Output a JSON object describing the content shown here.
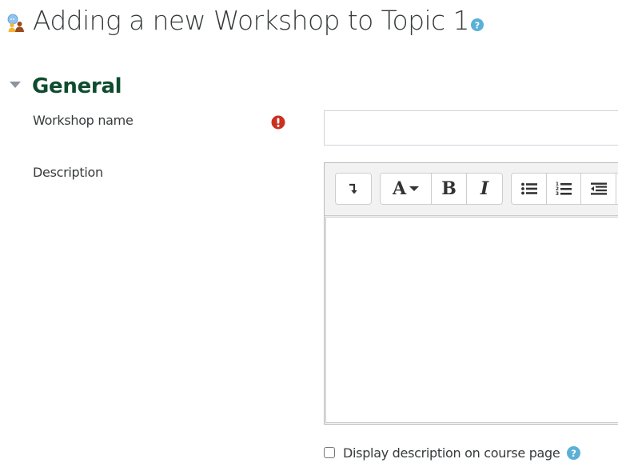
{
  "header": {
    "title": "Adding a new Workshop to Topic 1",
    "activity_icon": "workshop-icon",
    "help_icon": "question-circle-icon"
  },
  "section": {
    "title": "General",
    "collapse_icon": "caret-down-icon"
  },
  "fields": {
    "workshop_name": {
      "label": "Workshop name",
      "value": "",
      "required_icon": "exclamation-circle-icon"
    },
    "description": {
      "label": "Description",
      "value": "",
      "toolbar": [
        {
          "group": "show-more",
          "buttons": [
            {
              "name": "show-more-buttons",
              "icon": "arrow-down-hook-icon"
            }
          ]
        },
        {
          "group": "style",
          "buttons": [
            {
              "name": "paragraph-styles",
              "label": "A",
              "icon": "caret-down-icon"
            },
            {
              "name": "bold",
              "label": "B"
            },
            {
              "name": "italic",
              "label": "I"
            }
          ]
        },
        {
          "group": "list",
          "buttons": [
            {
              "name": "unordered-list",
              "icon": "bullet-list-icon"
            },
            {
              "name": "ordered-list",
              "icon": "numbered-list-icon"
            },
            {
              "name": "outdent",
              "icon": "outdent-icon"
            }
          ]
        }
      ]
    },
    "display_description": {
      "label": "Display description on course page",
      "checked": false,
      "help_icon": "question-circle-icon"
    }
  },
  "colors": {
    "section_title": "#0f4b2e",
    "required": "#ca3120",
    "help": "#5bb0d8",
    "text": "#373a3c"
  }
}
